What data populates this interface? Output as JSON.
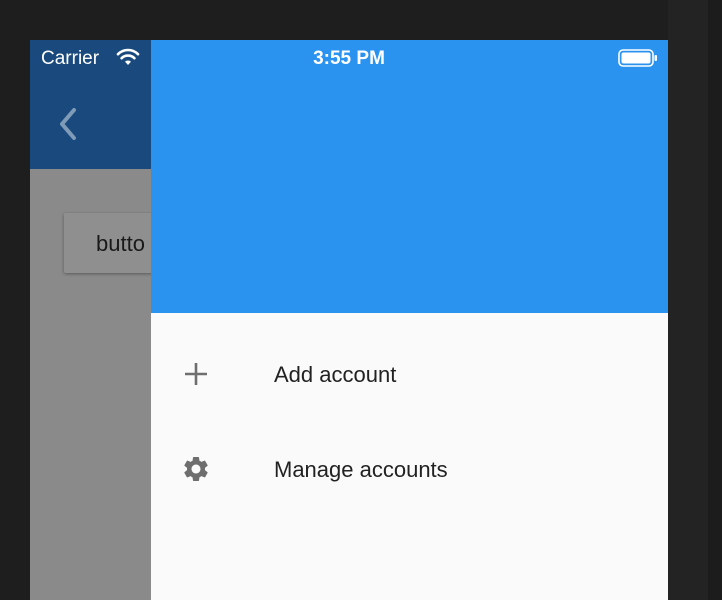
{
  "status_bar": {
    "carrier": "Carrier",
    "time": "3:55 PM",
    "wifi_icon": "wifi-icon",
    "battery_icon": "battery-icon"
  },
  "underlay": {
    "back_icon": "chevron-left-icon",
    "button_label": "butto"
  },
  "drawer": {
    "header_color": "#2a93f0",
    "items": [
      {
        "icon": "plus-icon",
        "label": "Add account"
      },
      {
        "icon": "gear-icon",
        "label": "Manage accounts"
      }
    ]
  },
  "colors": {
    "accent": "#2a93f0",
    "underlay_appbar": "#1a4a7d",
    "scrim": "#8a8a8a"
  }
}
